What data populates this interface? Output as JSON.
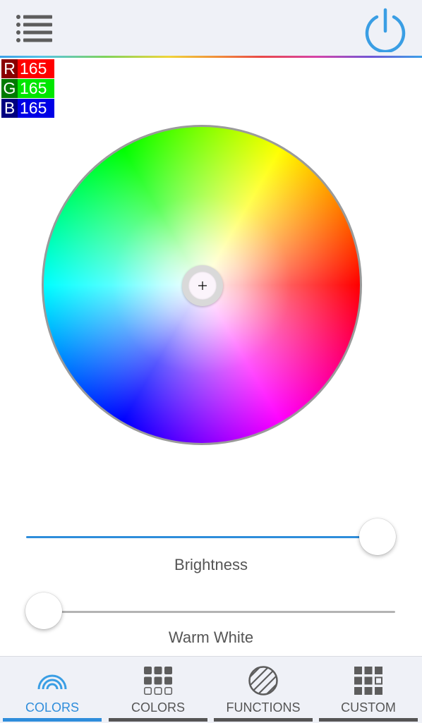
{
  "header": {
    "menu_icon": "list-icon",
    "power_icon": "power-icon",
    "accent_color": "#3a9ee4"
  },
  "rgb": {
    "r_label": "R",
    "r_value": "165",
    "g_label": "G",
    "g_value": "165",
    "b_label": "B",
    "b_value": "165"
  },
  "color_wheel": {
    "selected_color": "#a5a5a5"
  },
  "sliders": {
    "brightness": {
      "label": "Brightness",
      "value_fraction": 1.0
    },
    "warm_white": {
      "label": "Warm White",
      "value_fraction": 0.0
    }
  },
  "tabs": [
    {
      "label": "COLORS",
      "icon": "rainbow-icon",
      "active": true
    },
    {
      "label": "COLORS",
      "icon": "color-grid-icon",
      "active": false
    },
    {
      "label": "FUNCTIONS",
      "icon": "striped-circle-icon",
      "active": false
    },
    {
      "label": "CUSTOM",
      "icon": "custom-grid-icon",
      "active": false
    }
  ]
}
